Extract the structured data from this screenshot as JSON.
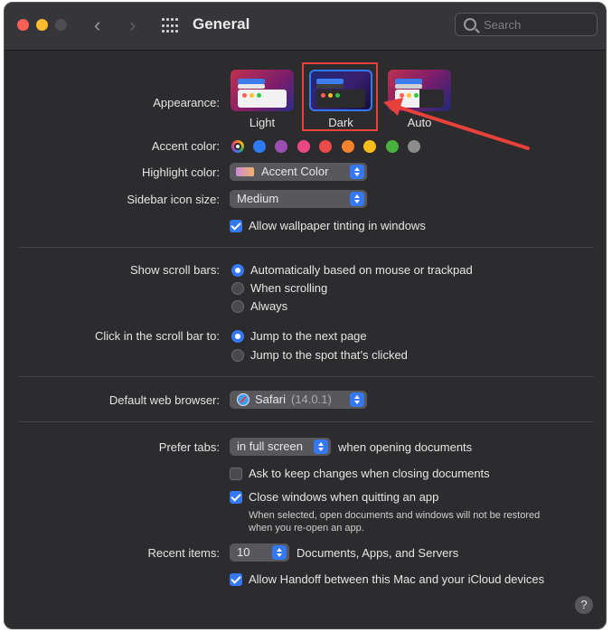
{
  "window": {
    "title": "General"
  },
  "search": {
    "placeholder": "Search"
  },
  "appearance": {
    "label": "Appearance:",
    "options": [
      "Light",
      "Dark",
      "Auto"
    ],
    "selected": "Dark"
  },
  "accent": {
    "label": "Accent color:",
    "colors": [
      "#a35ec4",
      "#2f7bf5",
      "#9b4fb3",
      "#e9477f",
      "#ed4a4c",
      "#f2822d",
      "#f9bd1a",
      "#47b23e",
      "#8c8c8c"
    ]
  },
  "highlight": {
    "label": "Highlight color:",
    "value": "Accent Color"
  },
  "sidebar_icon_size": {
    "label": "Sidebar icon size:",
    "value": "Medium"
  },
  "wallpaper_tinting": {
    "label": "Allow wallpaper tinting in windows",
    "checked": true
  },
  "scroll_bars": {
    "label": "Show scroll bars:",
    "options": [
      "Automatically based on mouse or trackpad",
      "When scrolling",
      "Always"
    ],
    "selected": "Automatically based on mouse or trackpad"
  },
  "scroll_click": {
    "label": "Click in the scroll bar to:",
    "options": [
      "Jump to the next page",
      "Jump to the spot that’s clicked"
    ],
    "selected": "Jump to the next page"
  },
  "browser": {
    "label": "Default web browser:",
    "name": "Safari",
    "version": "(14.0.1)"
  },
  "tabs": {
    "label": "Prefer tabs:",
    "value": "in full screen",
    "suffix": "when opening documents"
  },
  "ask_changes": {
    "label": "Ask to keep changes when closing documents",
    "checked": false
  },
  "close_windows": {
    "label": "Close windows when quitting an app",
    "checked": true,
    "note_line1": "When selected, open documents and windows will not be restored",
    "note_line2": "when you re-open an app."
  },
  "recent": {
    "label": "Recent items:",
    "value": "10",
    "suffix": "Documents, Apps, and Servers"
  },
  "handoff": {
    "label": "Allow Handoff between this Mac and your iCloud devices",
    "checked": true
  },
  "help": {
    "symbol": "?"
  },
  "annotation": {
    "color": "#e8403a"
  }
}
